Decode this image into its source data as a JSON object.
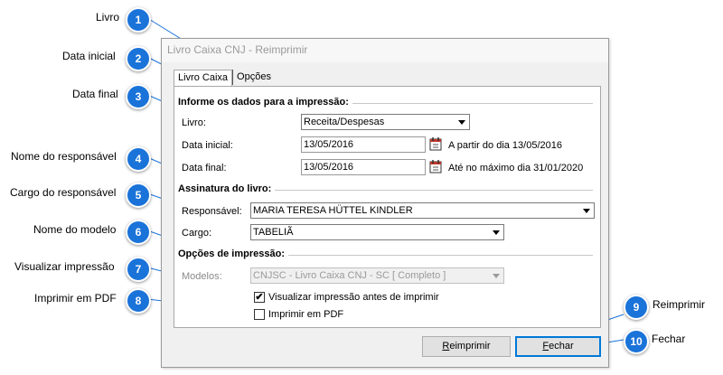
{
  "window": {
    "title": "Livro Caixa CNJ - Reimprimir",
    "tabs": [
      "Livro Caixa",
      "Opções"
    ]
  },
  "groups": {
    "print_info": "Informe os dados para a impressão:",
    "signature": "Assinatura do livro:",
    "print_options": "Opções de impressão:"
  },
  "fields": {
    "livro": {
      "label": "Livro:",
      "value": "Receita/Despesas"
    },
    "data_inicial": {
      "label": "Data inicial:",
      "value": "13/05/2016",
      "hint": "A partir do dia 13/05/2016"
    },
    "data_final": {
      "label": "Data final:",
      "value": "13/05/2016",
      "hint": "Até no máximo dia 31/01/2020"
    },
    "responsavel": {
      "label": "Responsável:",
      "value": "MARIA TERESA HÜTTEL KINDLER"
    },
    "cargo": {
      "label": "Cargo:",
      "value": "TABELIÃ"
    },
    "modelos": {
      "label": "Modelos:",
      "value": "CNJSC - Livro Caixa CNJ - SC [ Completo ]"
    }
  },
  "checkboxes": {
    "visualizar": {
      "label": "Visualizar impressão antes de imprimir",
      "checked": true,
      "mark": "✔"
    },
    "pdf": {
      "label": "Imprimir em PDF",
      "checked": false
    }
  },
  "buttons": {
    "reimprimir_accel": "R",
    "reimprimir_rest": "eimprimir",
    "fechar_accel": "F",
    "fechar_rest": "echar"
  },
  "annotations": [
    {
      "n": "1",
      "label": "Livro"
    },
    {
      "n": "2",
      "label": "Data inicial"
    },
    {
      "n": "3",
      "label": "Data final"
    },
    {
      "n": "4",
      "label": "Nome do responsável"
    },
    {
      "n": "5",
      "label": "Cargo do responsável"
    },
    {
      "n": "6",
      "label": "Nome do modelo"
    },
    {
      "n": "7",
      "label": "Visualizar impressão"
    },
    {
      "n": "8",
      "label": "Imprimir em PDF"
    },
    {
      "n": "9",
      "label": "Reimprimir"
    },
    {
      "n": "10",
      "label": "Fechar"
    }
  ],
  "colors": {
    "badge": "#1a73d9",
    "focus": "#0078d7"
  }
}
